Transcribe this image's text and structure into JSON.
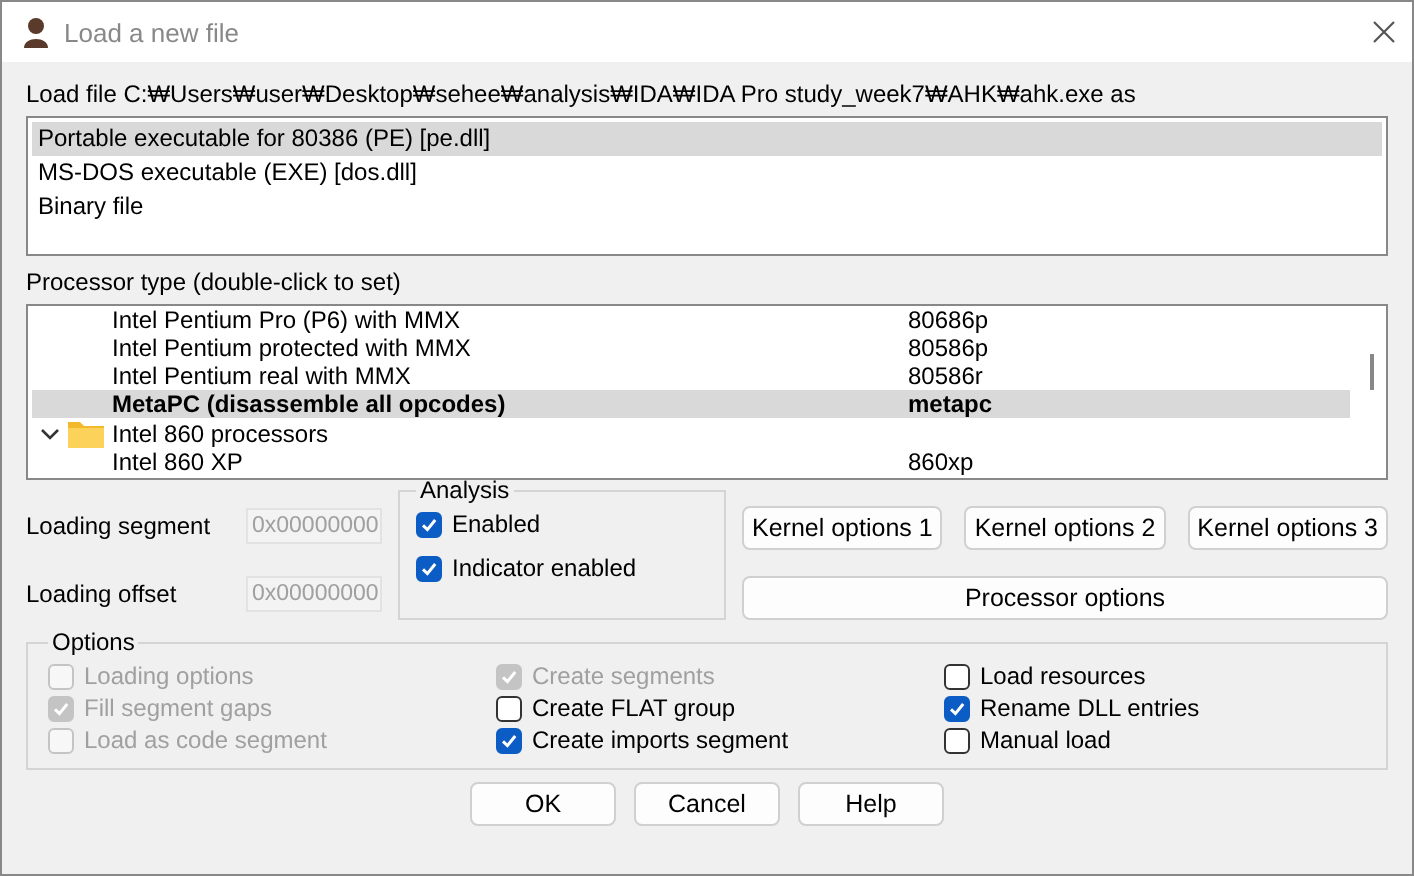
{
  "window": {
    "title": "Load a new file"
  },
  "load_file_label": "Load file C:₩Users₩user₩Desktop₩sehee₩analysis₩IDA₩IDA Pro study_week7₩AHK₩ahk.exe as",
  "file_types": [
    {
      "label": "Portable executable for 80386 (PE) [pe.dll]",
      "selected": true
    },
    {
      "label": "MS-DOS executable (EXE) [dos.dll]",
      "selected": false
    },
    {
      "label": "Binary file",
      "selected": false
    }
  ],
  "processor_label": "Processor type (double-click to set)",
  "processors": [
    {
      "kind": "processor",
      "name": "Intel Pentium Pro (P6) with MMX",
      "code": "80686p",
      "selected": false
    },
    {
      "kind": "processor",
      "name": "Intel Pentium protected with MMX",
      "code": "80586p",
      "selected": false
    },
    {
      "kind": "processor",
      "name": "Intel Pentium real with MMX",
      "code": "80586r",
      "selected": false
    },
    {
      "kind": "processor",
      "name": "MetaPC (disassemble all opcodes)",
      "code": "metapc",
      "selected": true
    },
    {
      "kind": "folder",
      "name": "Intel 860 processors",
      "expanded": true,
      "children": [
        {
          "kind": "processor",
          "name": "Intel 860 XP",
          "code": "860xp",
          "selected": false
        }
      ]
    }
  ],
  "loading_segment": {
    "label": "Loading segment",
    "value": "0x00000000"
  },
  "loading_offset": {
    "label": "Loading offset",
    "value": "0x00000000"
  },
  "analysis": {
    "title": "Analysis",
    "options": [
      {
        "label": "Enabled",
        "checked": true
      },
      {
        "label": "Indicator enabled",
        "checked": true
      }
    ]
  },
  "kernel_buttons": [
    "Kernel options 1",
    "Kernel options 2",
    "Kernel options 3"
  ],
  "processor_options_button": "Processor options",
  "options": {
    "title": "Options",
    "columns": [
      [
        {
          "label": "Loading options",
          "checked": false,
          "disabled": true
        },
        {
          "label": "Fill segment gaps",
          "checked": true,
          "disabled": true
        },
        {
          "label": "Load as code segment",
          "checked": false,
          "disabled": true
        }
      ],
      [
        {
          "label": "Create segments",
          "checked": true,
          "disabled": true
        },
        {
          "label": "Create FLAT group",
          "checked": false,
          "disabled": false
        },
        {
          "label": "Create imports segment",
          "checked": true,
          "disabled": false
        }
      ],
      [
        {
          "label": "Load resources",
          "checked": false,
          "disabled": false
        },
        {
          "label": "Rename DLL entries",
          "checked": true,
          "disabled": false
        },
        {
          "label": "Manual load",
          "checked": false,
          "disabled": false
        }
      ]
    ]
  },
  "buttons": [
    "OK",
    "Cancel",
    "Help"
  ]
}
